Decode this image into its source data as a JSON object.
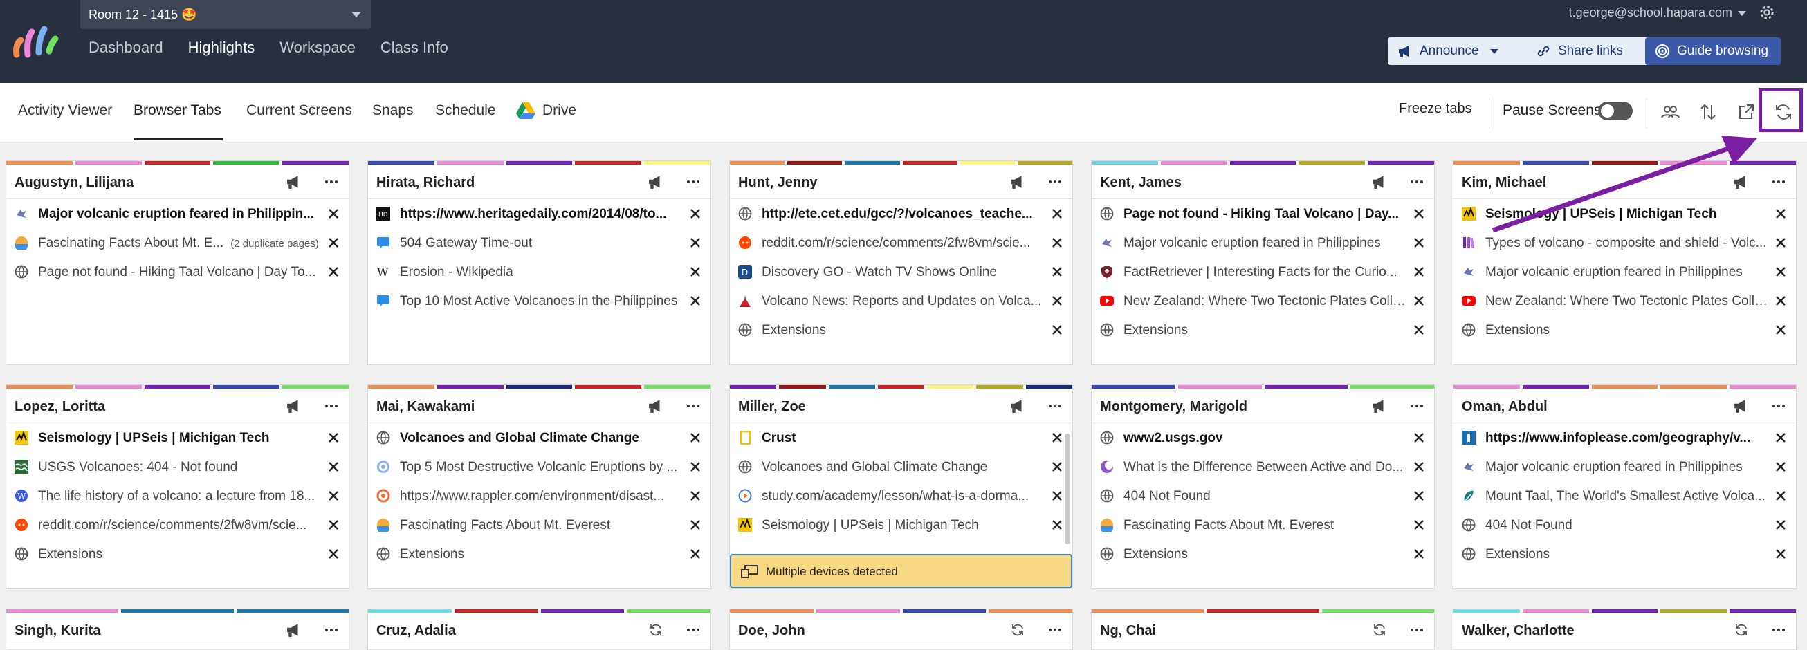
{
  "header": {
    "room": "Room 12 - 1415 🤩",
    "nav": [
      "Dashboard",
      "Highlights",
      "Workspace",
      "Class Info"
    ],
    "active_nav": "Highlights",
    "user": "t.george@school.hapara.com",
    "announce": "Announce",
    "share_links": "Share links",
    "guide_browsing": "Guide browsing"
  },
  "subnav": {
    "tabs": [
      "Activity Viewer",
      "Browser Tabs",
      "Current Screens",
      "Snaps",
      "Schedule",
      "Drive"
    ],
    "active_tab": "Browser Tabs",
    "freeze_tabs": "Freeze tabs",
    "pause_screens": "Pause Screens"
  },
  "colors": {
    "topbar": "#283040",
    "highlight": "#7a1fa2",
    "warning": "#f7d984"
  },
  "students": [
    {
      "name": "Augustyn, Lilijana",
      "stripes": [
        "#f28c4f",
        "#ee86d8",
        "#d21f1f",
        "#33bb33",
        "#7a1fbf"
      ],
      "tabs": [
        {
          "title": "Major volcanic eruption feared in Philippin...",
          "bold": true,
          "icon": "bird-icon"
        },
        {
          "title": "Fascinating Facts About Mt. E...",
          "dup": "(2 duplicate pages)",
          "icon": "sun-icon"
        },
        {
          "title": "Page not found - Hiking Taal Volcano | Day To...",
          "icon": "globe-icon"
        }
      ]
    },
    {
      "name": "Hirata, Richard",
      "stripes": [
        "#3448b8",
        "#ee86d8",
        "#7a1fbf",
        "#d21f1f",
        "#fdf27a"
      ],
      "tabs": [
        {
          "title": "https://www.heritagedaily.com/2014/08/to...",
          "bold": true,
          "icon": "hd-icon"
        },
        {
          "title": "504 Gateway Time-out",
          "icon": "chat-icon"
        },
        {
          "title": "Erosion - Wikipedia",
          "icon": "wikipedia-icon"
        },
        {
          "title": "Top 10 Most Active Volcanoes in the Philippines",
          "icon": "chat-icon"
        }
      ]
    },
    {
      "name": "Hunt, Jenny",
      "stripes": [
        "#f28c4f",
        "#991515",
        "#1a78b0",
        "#d21f1f",
        "#fdf27a",
        "#b8a820"
      ],
      "tabs": [
        {
          "title": "http://ete.cet.edu/gcc/?/volcanoes_teache...",
          "bold": true,
          "icon": "globe-icon"
        },
        {
          "title": "reddit.com/r/science/comments/2fw8vm/scie...",
          "icon": "reddit-icon"
        },
        {
          "title": "Discovery GO - Watch TV Shows Online",
          "icon": "discovery-icon"
        },
        {
          "title": "Volcano News: Reports and Updates on Volca...",
          "icon": "volcano-icon"
        },
        {
          "title": "Extensions",
          "icon": "globe-icon"
        }
      ]
    },
    {
      "name": "Kent, James",
      "stripes": [
        "#6fd0f0",
        "#ee86d8",
        "#7a1fbf",
        "#b8a820",
        "#7a1fbf"
      ],
      "tabs": [
        {
          "title": "Page not found - Hiking Taal Volcano | Day...",
          "bold": true,
          "icon": "globe-icon"
        },
        {
          "title": "Major volcanic eruption feared in Philippines",
          "icon": "bird-icon"
        },
        {
          "title": "FactRetriever | Interesting Facts for the Curio...",
          "icon": "shield-icon"
        },
        {
          "title": "New Zealand: Where Two Tectonic Plates Colli...",
          "icon": "youtube-icon"
        },
        {
          "title": "Extensions",
          "icon": "globe-icon"
        }
      ]
    },
    {
      "name": "Kim, Michael",
      "stripes": [
        "#f28c4f",
        "#3448b8",
        "#991515",
        "#ee86d8",
        "#7a1fbf"
      ],
      "tabs": [
        {
          "title": "Seismology | UPSeis | Michigan Tech",
          "bold": true,
          "icon": "upseis-icon"
        },
        {
          "title": "Types of volcano - composite and shield - Volc...",
          "icon": "books-icon"
        },
        {
          "title": "Major volcanic eruption feared in Philippines",
          "icon": "bird-icon"
        },
        {
          "title": "New Zealand: Where Two Tectonic Plates Colli...",
          "icon": "youtube-icon"
        },
        {
          "title": "Extensions",
          "icon": "globe-icon"
        }
      ]
    },
    {
      "name": "Lopez, Loritta",
      "stripes": [
        "#f28c4f",
        "#ee86d8",
        "#7a1fbf",
        "#3448b8",
        "#6fe060"
      ],
      "tabs": [
        {
          "title": "Seismology | UPSeis | Michigan Tech",
          "bold": true,
          "icon": "upseis-icon"
        },
        {
          "title": "USGS Volcanoes: 404 - Not found",
          "icon": "usgs-icon"
        },
        {
          "title": "The life history of a volcano: a lecture from 18...",
          "icon": "wordpress-icon"
        },
        {
          "title": "reddit.com/r/science/comments/2fw8vm/scie...",
          "icon": "reddit-icon"
        },
        {
          "title": "Extensions",
          "icon": "globe-icon"
        }
      ]
    },
    {
      "name": "Mai, Kawakami",
      "stripes": [
        "#f28c4f",
        "#7a1fbf",
        "#1a2a80",
        "#d21f1f",
        "#6fe060"
      ],
      "tabs": [
        {
          "title": "Volcanoes and Global Climate Change",
          "bold": true,
          "icon": "globe-icon"
        },
        {
          "title": "Top 5 Most Destructive Volcanic Eruptions by ...",
          "icon": "target-icon"
        },
        {
          "title": "https://www.rappler.com/environment/disast...",
          "icon": "rappler-icon"
        },
        {
          "title": "Fascinating Facts About Mt. Everest",
          "icon": "sun-icon"
        },
        {
          "title": "Extensions",
          "icon": "globe-icon"
        }
      ]
    },
    {
      "name": "Miller, Zoe",
      "stripes": [
        "#7a1fbf",
        "#991515",
        "#1a78b0",
        "#d21f1f",
        "#fdf27a",
        "#b8a820",
        "#1a2a80"
      ],
      "warning": "Multiple devices detected",
      "tabs": [
        {
          "title": "Crust",
          "bold": true,
          "icon": "doc-icon"
        },
        {
          "title": "Volcanoes and Global Climate Change",
          "icon": "globe-icon"
        },
        {
          "title": "study.com/academy/lesson/what-is-a-dorma...",
          "icon": "play-icon"
        },
        {
          "title": "Seismology | UPSeis | Michigan Tech",
          "icon": "upseis-icon"
        }
      ]
    },
    {
      "name": "Montgomery, Marigold",
      "stripes": [
        "#3448b8",
        "#ee86d8",
        "#7a1fbf",
        "#6fe060"
      ],
      "tabs": [
        {
          "title": "www2.usgs.gov",
          "bold": true,
          "icon": "globe-icon"
        },
        {
          "title": "What is the Difference Between Active and Do...",
          "icon": "moon-icon"
        },
        {
          "title": "404 Not Found",
          "icon": "globe-icon"
        },
        {
          "title": "Fascinating Facts About Mt. Everest",
          "icon": "sun-icon"
        },
        {
          "title": "Extensions",
          "icon": "globe-icon"
        }
      ]
    },
    {
      "name": "Oman, Abdul",
      "stripes": [
        "#ee86d8",
        "#7a1fbf",
        "#f28c4f",
        "#f28c4f",
        "#ee86d8"
      ],
      "tabs": [
        {
          "title": "https://www.infoplease.com/geography/v...",
          "bold": true,
          "icon": "infoplease-icon"
        },
        {
          "title": "Major volcanic eruption feared in Philippines",
          "icon": "bird-icon"
        },
        {
          "title": "Mount Taal, The World's Smallest Active Volca...",
          "icon": "leaf-icon"
        },
        {
          "title": "404 Not Found",
          "icon": "globe-icon"
        },
        {
          "title": "Extensions",
          "icon": "globe-icon"
        }
      ]
    },
    {
      "name": "Singh, Kurita",
      "stripes": [
        "#ee86d8",
        "#1a78b0",
        "#1a78b0"
      ],
      "tabs": []
    },
    {
      "name": "Cruz, Adalia",
      "stripes": [
        "#6fe0f0",
        "#d21f1f",
        "#7a1fbf",
        "#6fe060"
      ],
      "tabs": []
    },
    {
      "name": "Doe, John",
      "stripes": [
        "#f28c4f",
        "#ee86d8",
        "#3448b8",
        "#f28c4f"
      ],
      "tabs": []
    },
    {
      "name": "Ng, Chai",
      "stripes": [
        "#f28c4f",
        "#d21f1f",
        "#6fe060"
      ],
      "tabs": []
    },
    {
      "name": "Walker, Charlotte",
      "stripes": [
        "#6fe0f0",
        "#ee86d8",
        "#7a1fbf",
        "#b8a820",
        "#7a1fbf"
      ],
      "tabs": []
    }
  ]
}
